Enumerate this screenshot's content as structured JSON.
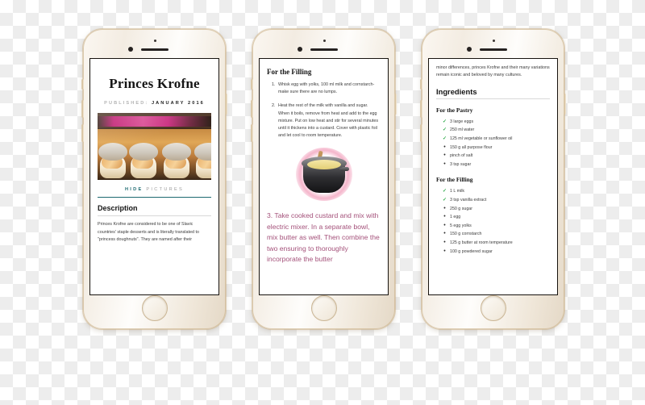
{
  "scene": {
    "title": "Three iPhone mockups showing a Princes Krofne recipe page",
    "device_color": "#f0e6d6",
    "accent_teal": "#1d6a70",
    "accent_pink": "#a4517a",
    "check_green": "#2faa4a"
  },
  "phone1": {
    "recipe_title": "Princes Krofne",
    "published_label": "PUBLISHED:",
    "published_value": "JANUARY 2016",
    "photo_alt": "cream-puff-pastries-photo",
    "hide_pictures_a": "HIDE",
    "hide_pictures_b": "PICTURES",
    "description_heading": "Description",
    "description_text": "Princes Krofne are considered to be one of Slavic countries' staple desserts and is literally translated to \"princess doughnuts\". They are named after their"
  },
  "phone2": {
    "section_heading": "For the Filling",
    "steps": [
      "Whisk egg with yolks, 100 ml milk and cornstarch- make sure there are no lumps.",
      "Heat the rest of the milk with vanilla and sugar. When it boils, remove from heat and add to the egg mixture. Put on low heat and stir for several minutes until it thickens into a custard. Cover with plastic foil and let cool to room temperature."
    ],
    "photo_alt": "custard-pot-photo",
    "highlight_step": "3. Take cooked custard and mix with electric mixer. In a separate bowl, mix butter as well. Then combine the two ensuring to thoroughly incorporate the butter"
  },
  "phone3": {
    "intro_text": "minor differences, princes Krofne and their many variations remain iconic and beloved by many cultures.",
    "ingredients_heading": "Ingredients",
    "pastry_heading": "For the Pastry",
    "pastry_items": [
      {
        "marker": "check",
        "text": "3 large eggs"
      },
      {
        "marker": "check",
        "text": "250 ml water"
      },
      {
        "marker": "check",
        "text": "125 ml vegetable or sunflower oil"
      },
      {
        "marker": "dot",
        "text": "150 g all purpose flour"
      },
      {
        "marker": "dot",
        "text": "pinch of salt"
      },
      {
        "marker": "dot",
        "text": "3 tsp sugar"
      }
    ],
    "filling_heading": "For the Filling",
    "filling_items": [
      {
        "marker": "check",
        "text": "1 L milk"
      },
      {
        "marker": "check",
        "text": "3 tsp vanilla extract"
      },
      {
        "marker": "dot",
        "text": "250 g sugar"
      },
      {
        "marker": "dot",
        "text": "1 egg"
      },
      {
        "marker": "dot",
        "text": "5 egg yolks"
      },
      {
        "marker": "dot",
        "text": "150 g cornstarch"
      },
      {
        "marker": "dot",
        "text": "125 g butter at room temperature"
      },
      {
        "marker": "dot",
        "text": "100 g powdered sugar"
      }
    ]
  },
  "glyphs": {
    "check": "✓",
    "bullet": "•"
  }
}
